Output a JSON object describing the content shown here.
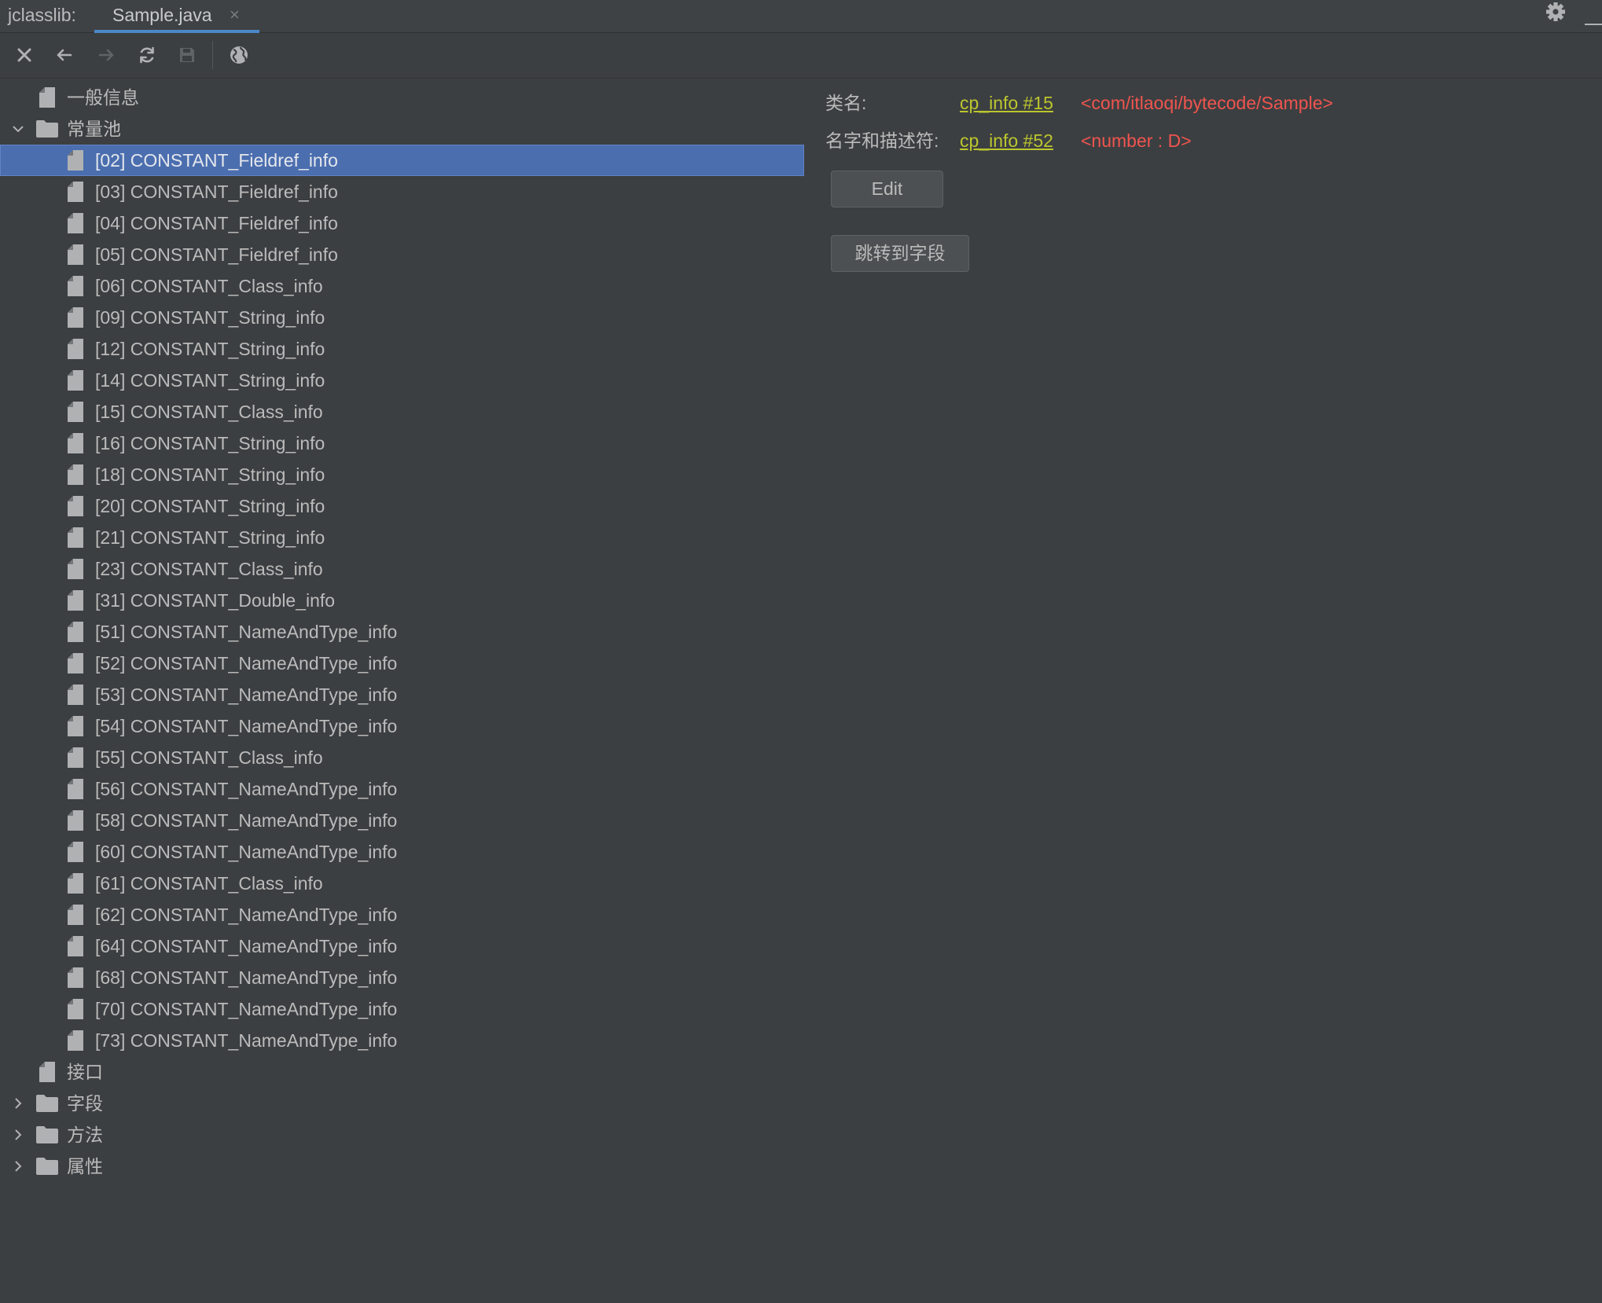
{
  "colors": {
    "background": "#3c3f41",
    "text": "#bbbbbb",
    "selection": "#4b6eaf",
    "link": "#bcc62e",
    "value": "#f0544f",
    "tab_accent": "#4a88c7"
  },
  "tabbar": {
    "tool_title": "jclasslib:",
    "tab_label": "Sample.java",
    "tab_close": "×",
    "right_icons": [
      "gear-icon",
      "minimize-icon"
    ]
  },
  "toolbar": {
    "buttons": [
      {
        "icon": "close-icon",
        "enabled": true
      },
      {
        "icon": "back-arrow-icon",
        "enabled": true
      },
      {
        "icon": "forward-arrow-icon",
        "enabled": false
      },
      {
        "icon": "refresh-icon",
        "enabled": true
      },
      {
        "icon": "save-icon",
        "enabled": false
      },
      {
        "icon": "globe-icon",
        "enabled": true
      }
    ]
  },
  "tree": {
    "nodes": [
      {
        "label": "一般信息",
        "icon": "file-icon",
        "expandable": false
      },
      {
        "label": "常量池",
        "icon": "folder-icon",
        "expandable": true,
        "expanded": true,
        "children": [
          {
            "label": "[02] CONSTANT_Fieldref_info",
            "icon": "file-icon",
            "selected": true
          },
          {
            "label": "[03] CONSTANT_Fieldref_info",
            "icon": "file-icon"
          },
          {
            "label": "[04] CONSTANT_Fieldref_info",
            "icon": "file-icon"
          },
          {
            "label": "[05] CONSTANT_Fieldref_info",
            "icon": "file-icon"
          },
          {
            "label": "[06] CONSTANT_Class_info",
            "icon": "file-icon"
          },
          {
            "label": "[09] CONSTANT_String_info",
            "icon": "file-icon"
          },
          {
            "label": "[12] CONSTANT_String_info",
            "icon": "file-icon"
          },
          {
            "label": "[14] CONSTANT_String_info",
            "icon": "file-icon"
          },
          {
            "label": "[15] CONSTANT_Class_info",
            "icon": "file-icon"
          },
          {
            "label": "[16] CONSTANT_String_info",
            "icon": "file-icon"
          },
          {
            "label": "[18] CONSTANT_String_info",
            "icon": "file-icon"
          },
          {
            "label": "[20] CONSTANT_String_info",
            "icon": "file-icon"
          },
          {
            "label": "[21] CONSTANT_String_info",
            "icon": "file-icon"
          },
          {
            "label": "[23] CONSTANT_Class_info",
            "icon": "file-icon"
          },
          {
            "label": "[31] CONSTANT_Double_info",
            "icon": "file-icon"
          },
          {
            "label": "[51] CONSTANT_NameAndType_info",
            "icon": "file-icon"
          },
          {
            "label": "[52] CONSTANT_NameAndType_info",
            "icon": "file-icon"
          },
          {
            "label": "[53] CONSTANT_NameAndType_info",
            "icon": "file-icon"
          },
          {
            "label": "[54] CONSTANT_NameAndType_info",
            "icon": "file-icon"
          },
          {
            "label": "[55] CONSTANT_Class_info",
            "icon": "file-icon"
          },
          {
            "label": "[56] CONSTANT_NameAndType_info",
            "icon": "file-icon"
          },
          {
            "label": "[58] CONSTANT_NameAndType_info",
            "icon": "file-icon"
          },
          {
            "label": "[60] CONSTANT_NameAndType_info",
            "icon": "file-icon"
          },
          {
            "label": "[61] CONSTANT_Class_info",
            "icon": "file-icon"
          },
          {
            "label": "[62] CONSTANT_NameAndType_info",
            "icon": "file-icon"
          },
          {
            "label": "[64] CONSTANT_NameAndType_info",
            "icon": "file-icon"
          },
          {
            "label": "[68] CONSTANT_NameAndType_info",
            "icon": "file-icon"
          },
          {
            "label": "[70] CONSTANT_NameAndType_info",
            "icon": "file-icon"
          },
          {
            "label": "[73] CONSTANT_NameAndType_info",
            "icon": "file-icon"
          }
        ]
      },
      {
        "label": "接口",
        "icon": "file-icon",
        "expandable": false
      },
      {
        "label": "字段",
        "icon": "folder-icon",
        "expandable": true,
        "expanded": false
      },
      {
        "label": "方法",
        "icon": "folder-icon",
        "expandable": true,
        "expanded": false
      },
      {
        "label": "属性",
        "icon": "folder-icon",
        "expandable": true,
        "expanded": false
      }
    ]
  },
  "detail": {
    "class_name": {
      "label": "类名:",
      "link": "cp_info #15",
      "value": "<com/itlaoqi/bytecode/Sample>"
    },
    "name_and_type": {
      "label": "名字和描述符:",
      "link": "cp_info #52",
      "value": "<number : D>"
    },
    "edit_button": "Edit",
    "goto_button": "跳转到字段"
  }
}
